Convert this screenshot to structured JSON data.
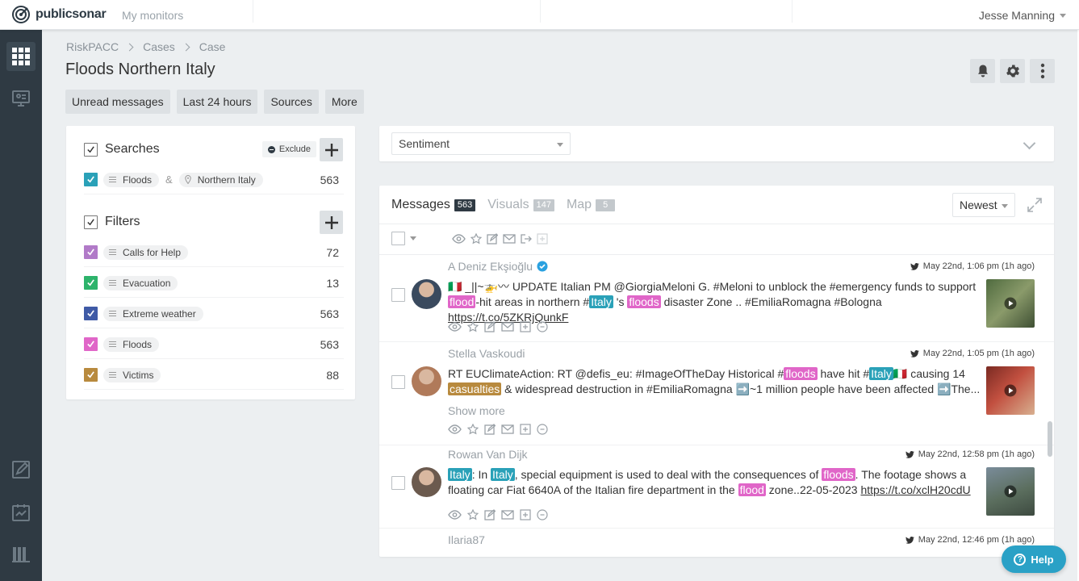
{
  "topbar": {
    "logo": "publicsonar",
    "nav_item": "My monitors",
    "user_name": "Jesse Manning"
  },
  "breadcrumb": [
    "RiskPACC",
    "Cases",
    "Case"
  ],
  "page_title": "Floods Northern Italy",
  "quick_filters": [
    "Unread messages",
    "Last 24 hours",
    "Sources",
    "More"
  ],
  "searches": {
    "title": "Searches",
    "exclude_label": "Exclude",
    "items": [
      {
        "term": "Floods",
        "location": "Northern Italy",
        "count": "563",
        "color": "#2aa1b8",
        "connector": "&"
      }
    ]
  },
  "filters": {
    "title": "Filters",
    "items": [
      {
        "label": "Calls for Help",
        "count": "72",
        "color": "#b17ac8"
      },
      {
        "label": "Evacuation",
        "count": "13",
        "color": "#2db36b"
      },
      {
        "label": "Extreme weather",
        "count": "563",
        "color": "#3f5aa6"
      },
      {
        "label": "Floods",
        "count": "563",
        "color": "#e066c8"
      },
      {
        "label": "Victims",
        "count": "88",
        "color": "#b88a3e"
      }
    ]
  },
  "sentiment": {
    "label": "Sentiment"
  },
  "messages": {
    "tabs": [
      {
        "label": "Messages",
        "count": "563",
        "active": true
      },
      {
        "label": "Visuals",
        "count": "147",
        "active": false
      },
      {
        "label": "Map",
        "count": "5",
        "active": false
      }
    ],
    "sort": "Newest",
    "show_more": "Show more",
    "items": [
      {
        "author": "A Deniz Ekşioğlu",
        "date": "May 22nd, 1:06 pm (1h ago)",
        "parts": [
          {
            "t": "🇮🇹 _||~🚁〰 UPDATE Italian PM @GiorgiaMeloni G. #Meloni to unblock the #emergency funds to support "
          },
          {
            "t": "flood",
            "hl": "pink"
          },
          {
            "t": "-hit areas in northern #"
          },
          {
            "t": "Italy",
            "hl": "teal"
          },
          {
            "t": " 's "
          },
          {
            "t": "floods",
            "hl": "pink"
          },
          {
            "t": " disaster Zone .. #EmiliaRomagna #Bologna "
          },
          {
            "t": "https://t.co/5ZKRjQunkF",
            "link": true
          }
        ]
      },
      {
        "author": "Stella Vaskoudi",
        "date": "May 22nd, 1:05 pm (1h ago)",
        "parts": [
          {
            "t": "RT EUClimateAction: RT @defis_eu: #ImageOfTheDay Historical #"
          },
          {
            "t": "floods",
            "hl": "pink"
          },
          {
            "t": " have hit #"
          },
          {
            "t": "Italy",
            "hl": "teal"
          },
          {
            "t": "🇮🇹 causing 14 "
          },
          {
            "t": "casualties",
            "hl": "gold"
          },
          {
            "t": " & widespread destruction in #EmiliaRomagna ➡️~1 million people have been affected ➡️The..."
          }
        ]
      },
      {
        "author": "Rowan Van Dijk",
        "date": "May 22nd, 12:58 pm (1h ago)",
        "parts": [
          {
            "t": "Italy",
            "hl": "teal"
          },
          {
            "t": ": In "
          },
          {
            "t": "Italy",
            "hl": "teal"
          },
          {
            "t": ", special equipment is used to deal with the consequences of "
          },
          {
            "t": "floods",
            "hl": "pink"
          },
          {
            "t": ". The footage shows a floating car Fiat 6640A of the Italian fire department in the "
          },
          {
            "t": "flood",
            "hl": "pink"
          },
          {
            "t": " zone..22-05-2023 "
          },
          {
            "t": "https://t.co/xclH20cdU",
            "link": true
          }
        ]
      },
      {
        "author": "Ilaria87",
        "date": "May 22nd, 12:46 pm (1h ago)",
        "parts": []
      }
    ]
  },
  "help": {
    "label": "Help"
  },
  "colors": {
    "rail": "#2f3a43",
    "highlight_pink": "#e066c8",
    "highlight_teal": "#2aa1b8",
    "highlight_gold": "#b88a3e",
    "help": "#2aa1c6"
  }
}
